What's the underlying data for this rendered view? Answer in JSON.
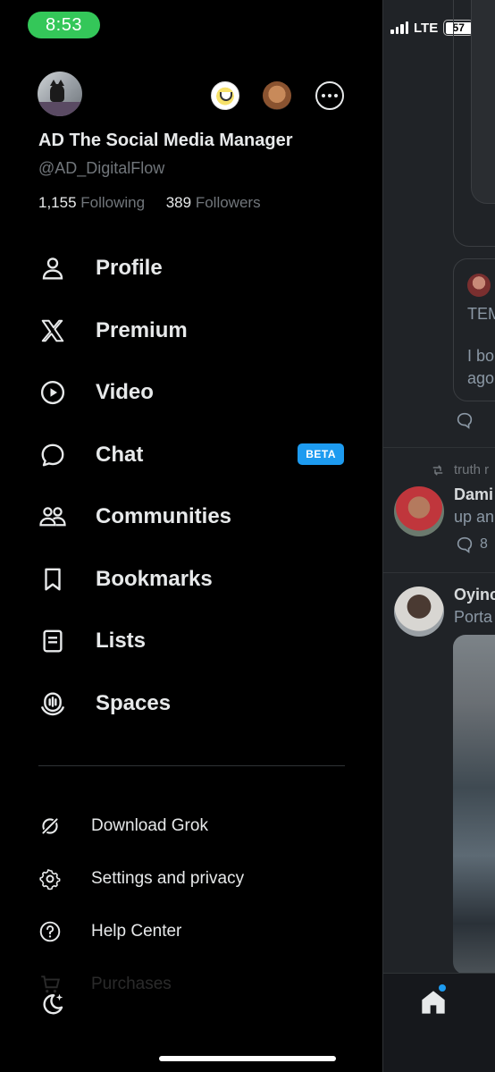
{
  "status_bar": {
    "time": "8:53",
    "network": "LTE",
    "battery": "57"
  },
  "profile": {
    "display_name": "AD The Social Media Manager",
    "handle": "@AD_DigitalFlow",
    "following_count": "1,155",
    "following_label": "Following",
    "followers_count": "389",
    "followers_label": "Followers"
  },
  "nav": [
    {
      "label": "Profile",
      "icon": "person-icon"
    },
    {
      "label": "Premium",
      "icon": "x-logo-icon"
    },
    {
      "label": "Video",
      "icon": "play-circle-icon"
    },
    {
      "label": "Chat",
      "icon": "chat-bubble-icon",
      "badge": "BETA"
    },
    {
      "label": "Communities",
      "icon": "communities-icon"
    },
    {
      "label": "Bookmarks",
      "icon": "bookmark-icon"
    },
    {
      "label": "Lists",
      "icon": "list-icon"
    },
    {
      "label": "Spaces",
      "icon": "spaces-icon"
    }
  ],
  "secondary": [
    {
      "label": "Download Grok",
      "icon": "grok-icon"
    },
    {
      "label": "Settings and privacy",
      "icon": "gear-icon"
    },
    {
      "label": "Help Center",
      "icon": "help-icon"
    },
    {
      "label": "Purchases",
      "icon": "cart-icon"
    }
  ],
  "background_feed": {
    "quote_text_1": "TEM",
    "quote_text_2": "I bo",
    "quote_text_3": "ago",
    "retweet_label": "truth r",
    "post1_name": "Dami",
    "post1_text": "up an",
    "post1_count": "8",
    "post2_name": "Oyinc",
    "post2_text": "Porta"
  },
  "colors": {
    "accent": "#1d9bf0",
    "time_pill": "#34c759",
    "background": "#000000"
  }
}
